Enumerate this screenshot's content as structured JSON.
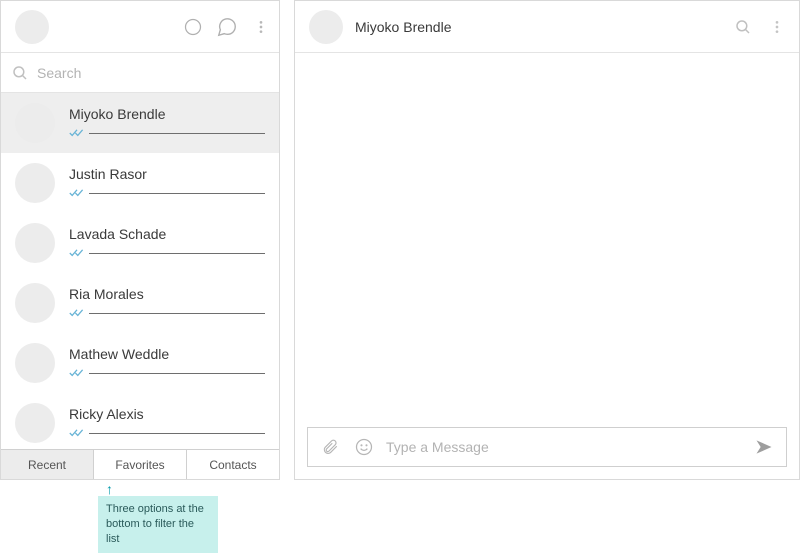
{
  "search": {
    "placeholder": "Search"
  },
  "chats": [
    {
      "name": "Miyoko Brendle",
      "selected": true
    },
    {
      "name": "Justin Rasor",
      "selected": false
    },
    {
      "name": "Lavada Schade",
      "selected": false
    },
    {
      "name": "Ria Morales",
      "selected": false
    },
    {
      "name": "Mathew Weddle",
      "selected": false
    },
    {
      "name": "Ricky Alexis",
      "selected": false
    }
  ],
  "tabs": {
    "recent": "Recent",
    "favorites": "Favorites",
    "contacts": "Contacts"
  },
  "conversation": {
    "title": "Miyoko Brendle"
  },
  "compose": {
    "placeholder": "Type a Message"
  },
  "annotation": {
    "text": "Three options at the bottom to filter the list"
  }
}
